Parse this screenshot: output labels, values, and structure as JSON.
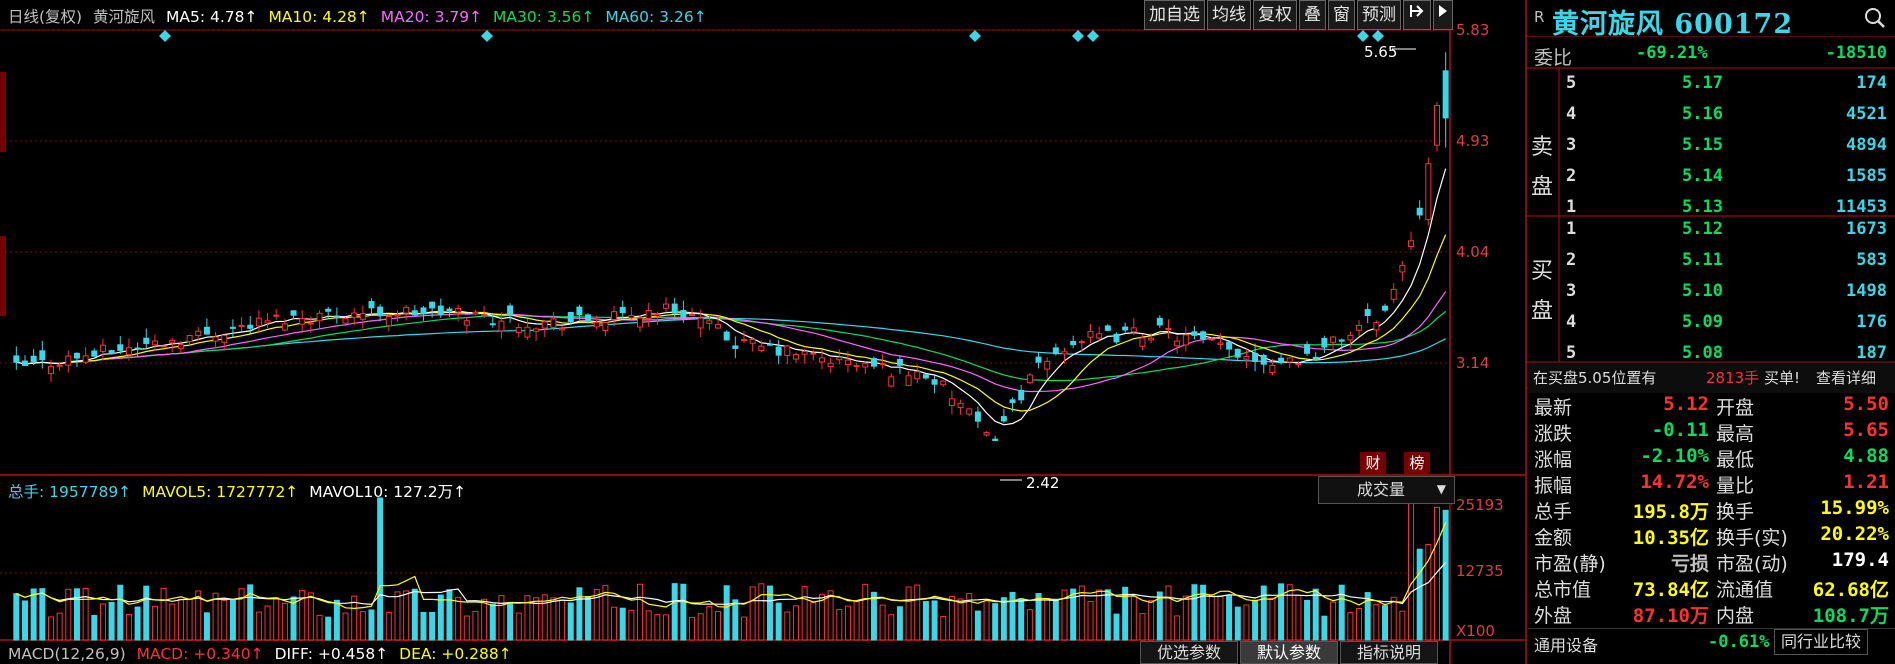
{
  "header": {
    "period": "日线(复权)",
    "name": "黄河旋风",
    "ma": [
      {
        "label": "MA5: 4.78↑",
        "color": "#ffffff"
      },
      {
        "label": "MA10: 4.28↑",
        "color": "#ffff00"
      },
      {
        "label": "MA20: 3.79↑",
        "color": "#ff66ff"
      },
      {
        "label": "MA30: 3.56↑",
        "color": "#00e060"
      },
      {
        "label": "MA60: 3.26↑",
        "color": "#3ad7e8"
      }
    ]
  },
  "toolbar": {
    "buttons": [
      "加自选",
      "均线",
      "复权",
      "叠",
      "窗",
      "预测"
    ],
    "expand_icon": "pin-icon",
    "collapse_icon": "triangle-right-icon"
  },
  "price_axis": {
    "labels": [
      "5.83",
      "4.93",
      "4.04",
      "3.14"
    ]
  },
  "markers": {
    "high_label": "5.65",
    "low_label": "2.42",
    "cai": "财",
    "bang": "榜"
  },
  "volume": {
    "header": [
      {
        "label": "总手: 1957789↑",
        "color": "#3ad7e8"
      },
      {
        "label": "MAVOL5: 1727772↑",
        "color": "#ffff00"
      },
      {
        "label": "MAVOL10: 127.2万↑",
        "color": "#ffffff"
      }
    ],
    "selector": "成交量",
    "axis": [
      "25193",
      "12735",
      "X100"
    ]
  },
  "macd": [
    {
      "label": "MACD(12,26,9)",
      "color": "#c0c0c0"
    },
    {
      "label": "MACD: +0.340↑",
      "color": "#ff3030"
    },
    {
      "label": "DIFF: +0.458↑",
      "color": "#ffffff"
    },
    {
      "label": "DEA: +0.288↑",
      "color": "#ffff00"
    }
  ],
  "bottom_tabs": [
    "优选参数",
    "默认参数",
    "指标说明"
  ],
  "quote": {
    "r_mark": "R",
    "title": "黄河旋风 600172",
    "weibi_label": "委比",
    "weibi_pct": "-69.21%",
    "weibi_val": "-18510",
    "sell_label": [
      "卖",
      "盘"
    ],
    "buy_label": [
      "买",
      "盘"
    ],
    "sell": [
      {
        "n": "5",
        "price": "5.17",
        "vol": "174"
      },
      {
        "n": "4",
        "price": "5.16",
        "vol": "4521"
      },
      {
        "n": "3",
        "price": "5.15",
        "vol": "4894"
      },
      {
        "n": "2",
        "price": "5.14",
        "vol": "1585"
      },
      {
        "n": "1",
        "price": "5.13",
        "vol": "11453"
      }
    ],
    "buy": [
      {
        "n": "1",
        "price": "5.12",
        "vol": "1673"
      },
      {
        "n": "2",
        "price": "5.11",
        "vol": "583"
      },
      {
        "n": "3",
        "price": "5.10",
        "vol": "1498"
      },
      {
        "n": "4",
        "price": "5.09",
        "vol": "176"
      },
      {
        "n": "5",
        "price": "5.08",
        "vol": "187"
      }
    ],
    "buy_notice": {
      "text": "在买盘5.05位置有",
      "qty": "2813手",
      "act": "买单!",
      "link": "查看详细"
    },
    "stats": [
      {
        "l1": "最新",
        "v1": "5.12",
        "c1": "#ff3030",
        "l2": "开盘",
        "v2": "5.50",
        "c2": "#ff3030"
      },
      {
        "l1": "涨跌",
        "v1": "-0.11",
        "c1": "#00e060",
        "l2": "最高",
        "v2": "5.65",
        "c2": "#ff3030"
      },
      {
        "l1": "涨幅",
        "v1": "-2.10%",
        "c1": "#00e060",
        "l2": "最低",
        "v2": "4.88",
        "c2": "#00e060"
      },
      {
        "l1": "振幅",
        "v1": "14.72%",
        "c1": "#ff3030",
        "l2": "量比",
        "v2": "1.21",
        "c2": "#ff3030"
      },
      {
        "l1": "总手",
        "v1": "195.8万",
        "c1": "#ffff00",
        "l2": "换手",
        "v2": "15.99%",
        "c2": "#ffff00"
      },
      {
        "l1": "金额",
        "v1": "10.35亿",
        "c1": "#ffff00",
        "l2": "换手(实)",
        "v2": "20.22%",
        "c2": "#ffff00"
      },
      {
        "l1": "市盈(静)",
        "v1": "亏损",
        "c1": "#c0c0c0",
        "l2": "市盈(动)",
        "v2": "179.4",
        "c2": "#ffffff"
      },
      {
        "l1": "总市值",
        "v1": "73.84亿",
        "c1": "#ffff00",
        "l2": "流通值",
        "v2": "62.68亿",
        "c2": "#ffff00"
      },
      {
        "l1": "外盘",
        "v1": "87.10万",
        "c1": "#ff3030",
        "l2": "内盘",
        "v2": "108.7万",
        "c2": "#00e060"
      }
    ],
    "industry": {
      "name": "通用设备",
      "pct": "-0.61%",
      "btn": "同行业比较"
    }
  },
  "colors": {
    "up": "#ff3030",
    "down": "#3ad7e8",
    "grid": "#7a1010",
    "border": "#b01010"
  }
}
